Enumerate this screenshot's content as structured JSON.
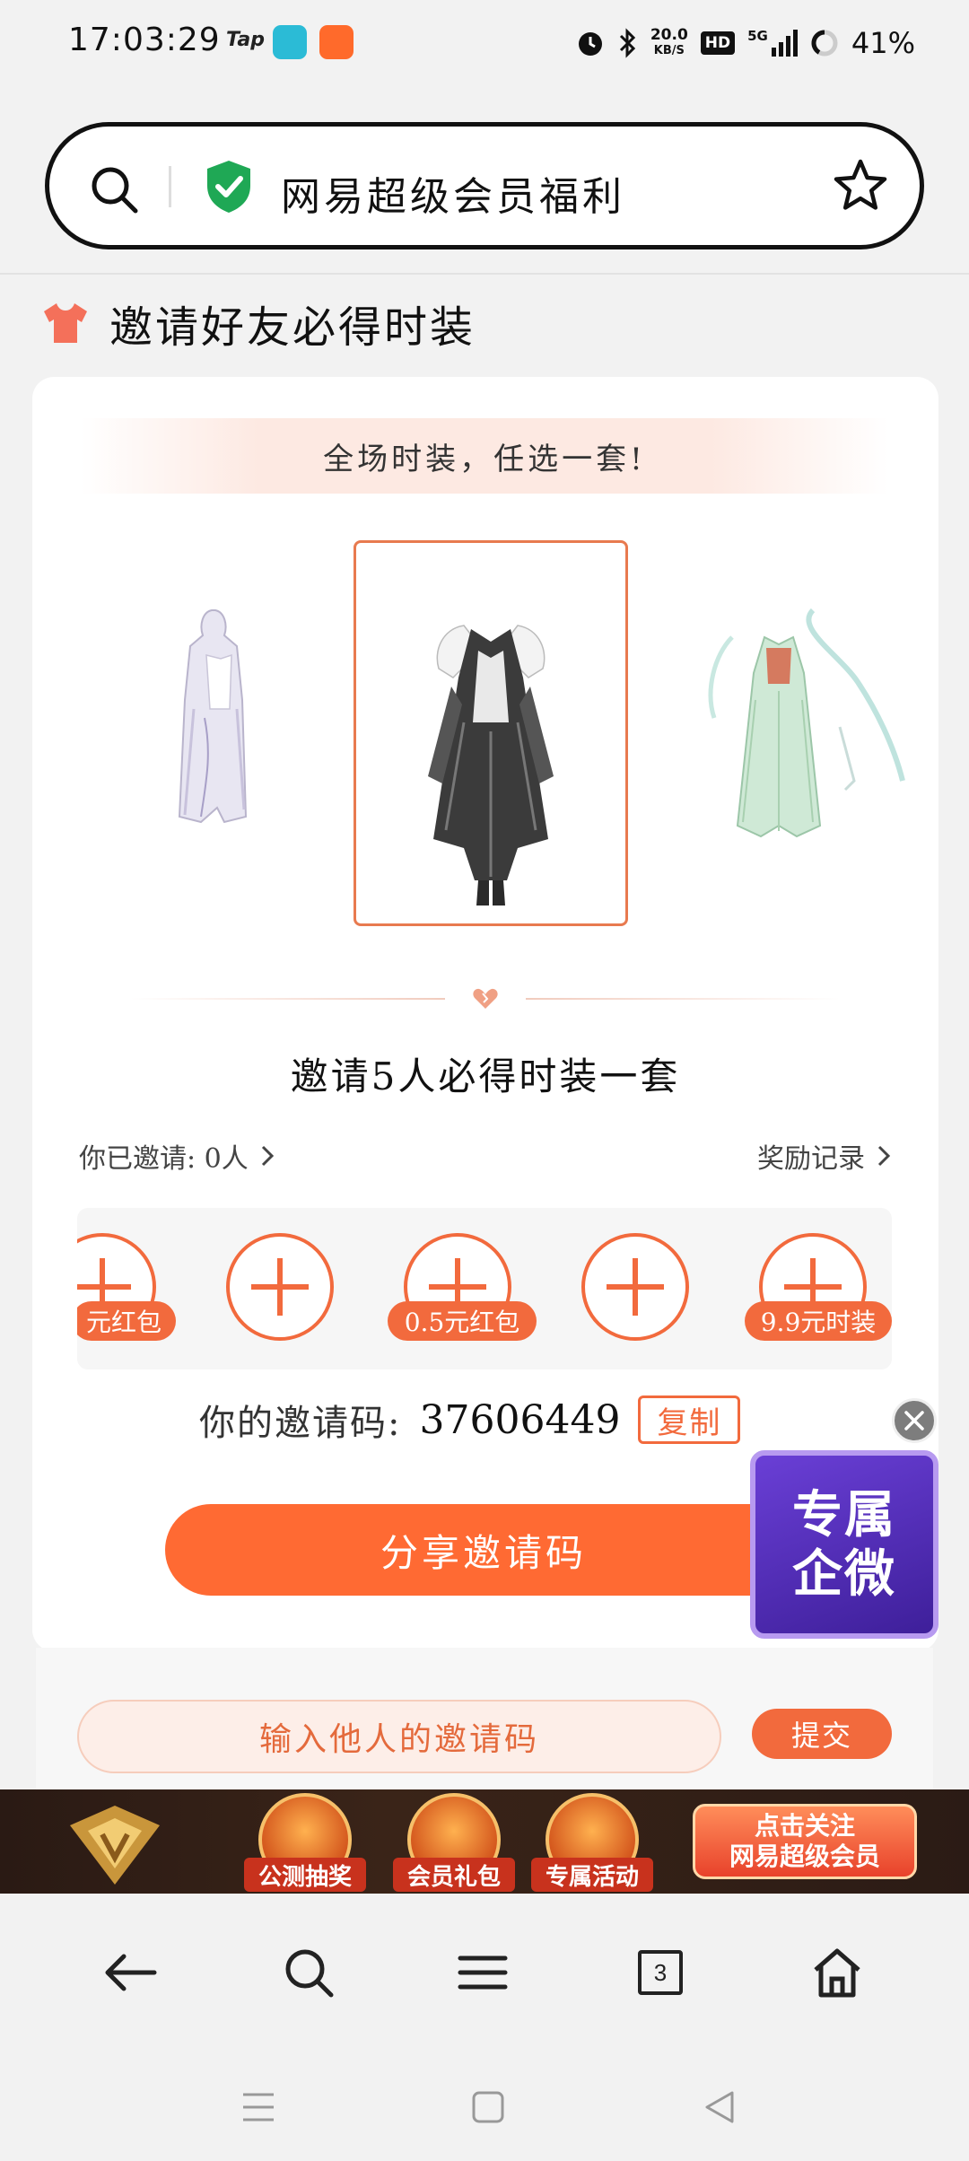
{
  "status_bar": {
    "time": "17:03:29",
    "tap_label": "Tap",
    "net_speed_value": "20.0",
    "net_speed_unit": "KB/S",
    "hd_label": "HD",
    "network_label": "5G",
    "battery": "41%"
  },
  "address_bar": {
    "title": "网易超级会员福利"
  },
  "section": {
    "title": "邀请好友必得时装"
  },
  "card": {
    "banner": "全场时装，任选一套!",
    "invite_title": "邀请5人必得时装一套",
    "invited_label": "你已邀请: 0人",
    "records_label": "奖励记录",
    "slot_tags": [
      "元红包",
      "0.5元红包",
      "9.9元时装"
    ],
    "code_label": "你的邀请码:",
    "code_value": "37606449",
    "copy_label": "复制",
    "share_label": "分享邀请码",
    "input_placeholder": "输入他人的邀请码",
    "submit_label": "提交"
  },
  "float_badge": {
    "line1": "专属",
    "line2": "企微"
  },
  "promo": {
    "items": [
      "公测抽奖",
      "会员礼包",
      "专属活动"
    ],
    "cta_line1": "点击关注",
    "cta_line2": "网易超级会员"
  },
  "toolbar": {
    "tab_count": "3"
  },
  "colors": {
    "accent": "#f26a3d",
    "share_button": "#ff6a33",
    "shield": "#1fa855"
  }
}
